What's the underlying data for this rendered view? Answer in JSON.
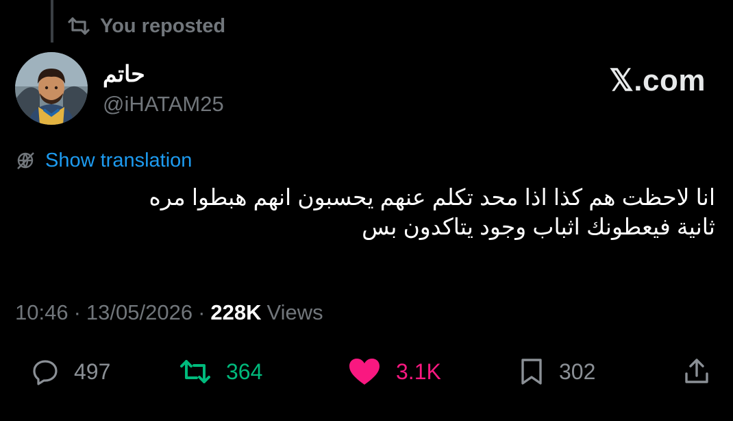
{
  "repost": {
    "label": "You reposted",
    "icon": "retweet-icon"
  },
  "author": {
    "name": "حاتم",
    "handle": "@iHATAM25",
    "avatar_icon": "avatar"
  },
  "watermark": "𝕏.com",
  "translate": {
    "label": "Show translation",
    "icon": "globe-slash-icon"
  },
  "tweet": {
    "line1": "انا لاحظت هم كذا اذا محد تكلم عنهم يحسبون انهم هبطوا مره",
    "line2": "ثانية فيعطونك اثباب وجود يتاكدون بس"
  },
  "meta": {
    "time": "10:46",
    "sep1": "·",
    "date": "13/05/2026",
    "sep2": "·",
    "views_count": "228K",
    "views_label": "Views"
  },
  "actions": {
    "reply": {
      "count": "497",
      "icon": "reply-icon"
    },
    "retweet": {
      "count": "364",
      "icon": "retweet-icon",
      "color": "#00ba7c"
    },
    "like": {
      "count": "3.1K",
      "icon": "heart-icon",
      "color": "#f91880"
    },
    "bookmark": {
      "count": "302",
      "icon": "bookmark-icon"
    },
    "share": {
      "icon": "share-icon"
    }
  }
}
